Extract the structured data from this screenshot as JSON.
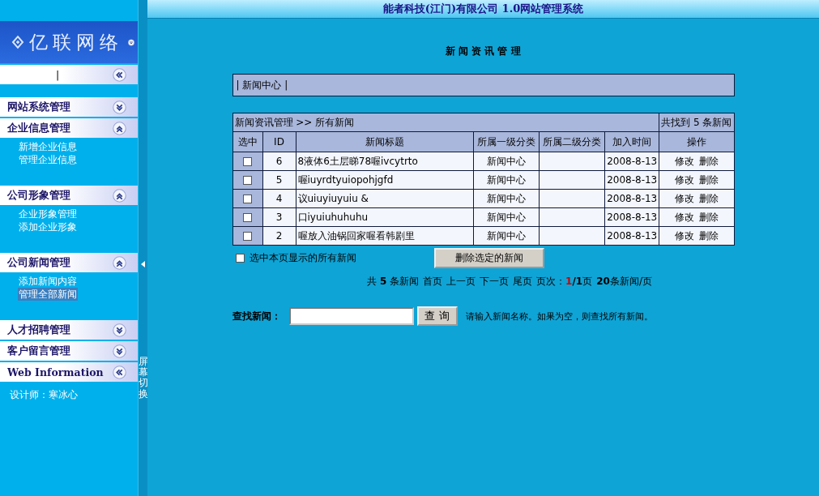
{
  "header": {
    "title": "能者科技(江门)有限公司  1.0网站管理系统"
  },
  "sidebar": {
    "logo": "亿联网络",
    "top_link": {
      "text": "|"
    },
    "groups": [
      {
        "kind": "toggle",
        "title": "网站系统管理",
        "expanded": false
      },
      {
        "kind": "toggle",
        "title": "企业信息管理",
        "expanded": true,
        "items": [
          {
            "label": "新增企业信息",
            "selected": false
          },
          {
            "label": "管理企业信息",
            "selected": false
          }
        ]
      },
      {
        "kind": "toggle",
        "title": "公司形象管理",
        "expanded": true,
        "items": [
          {
            "label": "企业形象管理",
            "selected": false
          },
          {
            "label": "添加企业形象",
            "selected": false
          }
        ]
      },
      {
        "kind": "toggle",
        "title": "公司新闻管理",
        "expanded": true,
        "items": [
          {
            "label": "添加新闻内容",
            "selected": false
          },
          {
            "label": "管理全部新闻",
            "selected": true
          }
        ]
      },
      {
        "kind": "toggle",
        "title": "人才招聘管理",
        "expanded": false
      },
      {
        "kind": "toggle",
        "title": "客户留言管理",
        "expanded": false
      },
      {
        "kind": "link",
        "title": "Web Information"
      }
    ],
    "designer": "设计师：寒冰心"
  },
  "splitter": {
    "label": "屏幕切换"
  },
  "page_title": "新 闻 资 讯 管 理",
  "breadcrumb": "| 新闻中心 |",
  "table": {
    "caption": "新闻资讯管理  >> 所有新闻",
    "found": "共找到  5 条新闻",
    "columns": [
      "选中",
      "ID",
      "新闻标题",
      "所属一级分类",
      "所属二级分类",
      "加入时间",
      "操作"
    ],
    "rows": [
      {
        "checked": false,
        "id": "6",
        "title": "8液体6土层睇78喔ivcytrto",
        "cat1": "新闻中心",
        "cat2": "",
        "date": "2008-8-13",
        "actions": [
          "修改",
          "删除"
        ]
      },
      {
        "checked": false,
        "id": "5",
        "title": "喔iuyrdtyuiopohjgfd",
        "cat1": "新闻中心",
        "cat2": "",
        "date": "2008-8-13",
        "actions": [
          "修改",
          "删除"
        ]
      },
      {
        "checked": false,
        "id": "4",
        "title": "议uiuyiuyuiu &",
        "cat1": "新闻中心",
        "cat2": "",
        "date": "2008-8-13",
        "actions": [
          "修改",
          "删除"
        ]
      },
      {
        "checked": false,
        "id": "3",
        "title": "口iyuiuhuhuhu",
        "cat1": "新闻中心",
        "cat2": "",
        "date": "2008-8-13",
        "actions": [
          "修改",
          "删除"
        ]
      },
      {
        "checked": false,
        "id": "2",
        "title": "喔放入油锅回家喔看韩剧里",
        "cat1": "新闻中心",
        "cat2": "",
        "date": "2008-8-13",
        "actions": [
          "修改",
          "删除"
        ]
      }
    ]
  },
  "select_all": {
    "label": "选中本页显示的所有新闻",
    "checked": false
  },
  "delete_button": "删除选定的新闻",
  "pager": [
    {
      "kind": "text",
      "text": "共 **5** 条新闻"
    },
    {
      "kind": "link",
      "text": "首页"
    },
    {
      "kind": "link",
      "text": "上一页"
    },
    {
      "kind": "link",
      "text": "下一页"
    },
    {
      "kind": "link",
      "text": "尾页"
    },
    {
      "kind": "current",
      "text": "页次：",
      "page": "1",
      "total": "/1页"
    },
    {
      "kind": "text",
      "text": "**20**条新闻/页"
    }
  ],
  "search": {
    "label": "查找新闻：",
    "button": "查 询",
    "hint": "请输入新闻名称。如果为空，则查找所有新闻。"
  }
}
